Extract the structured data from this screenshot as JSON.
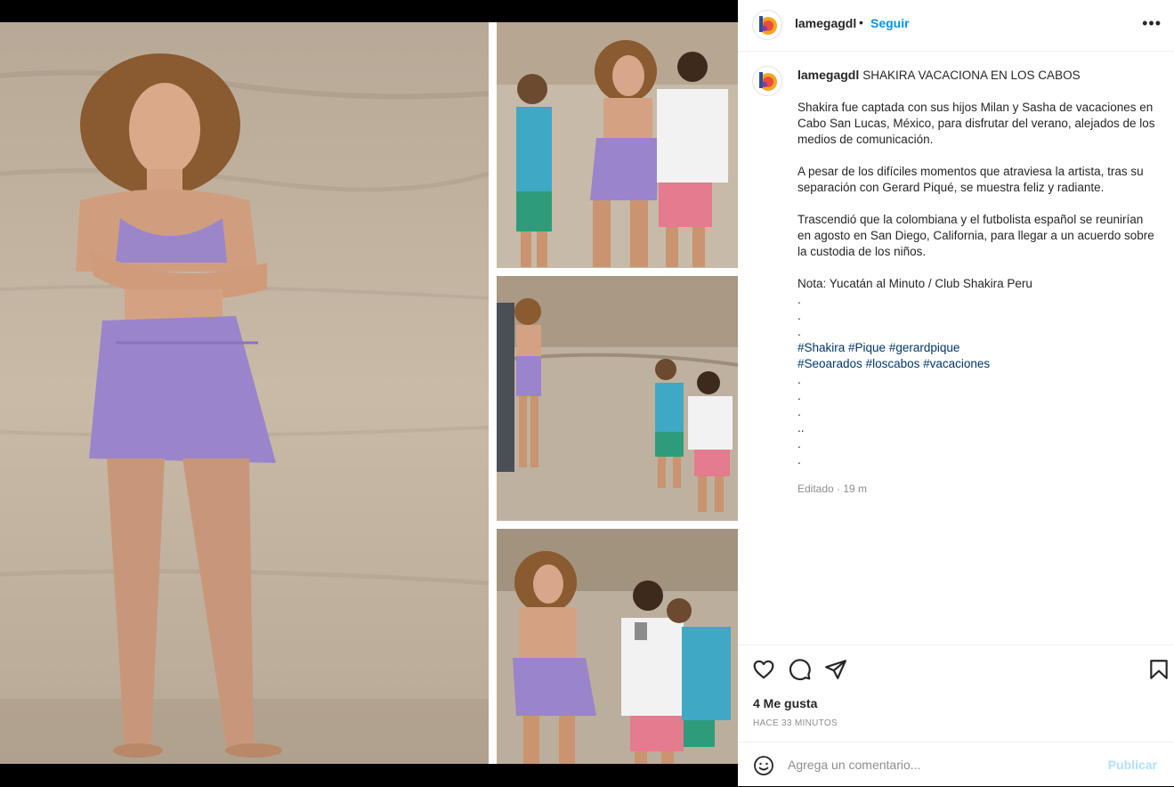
{
  "post": {
    "username": "lamegagdl",
    "separator": "•",
    "follow_label": "Seguir",
    "more_icon": "more-horizontal-icon"
  },
  "caption": {
    "username": "lamegagdl",
    "title": "SHAKIRA VACACIONA EN LOS CABOS",
    "paragraphs": [
      "Shakira fue captada con sus hijos Milan y Sasha de vacaciones en Cabo San Lucas, México, para disfrutar del verano, alejados de los medios de comunicación.",
      "A pesar de los difíciles momentos que atraviesa la artista, tras su separación con Gerard Piqué, se muestra feliz y radiante.",
      "Trascendió que la colombiana y el futbolista español se reunirían en agosto en San Diego, California, para llegar a un acuerdo sobre la custodia de los niños.",
      "Nota: Yucatán al Minuto / Club Shakira Peru"
    ],
    "dots_before": [
      ".",
      ".",
      "."
    ],
    "hashtags_line1": "#Shakira #Pique #gerardpique",
    "hashtags_line2": "#Seoarados #loscabos #vacaciones",
    "dots_after": [
      ".",
      ".",
      ".",
      "..",
      ".",
      "."
    ],
    "edited": "Editado · 19 m"
  },
  "actions": {
    "icons": [
      "heart-icon",
      "comment-icon",
      "share-icon",
      "bookmark-icon"
    ],
    "likes": "4 Me gusta",
    "time": "HACE 33 MINUTOS"
  },
  "comment_box": {
    "placeholder": "Agrega un comentario...",
    "publish_label": "Publicar"
  },
  "colors": {
    "accent": "#0095f6",
    "hashtag": "#00376b",
    "publish_disabled": "#b2dffc",
    "muted": "#8e8e8e"
  }
}
